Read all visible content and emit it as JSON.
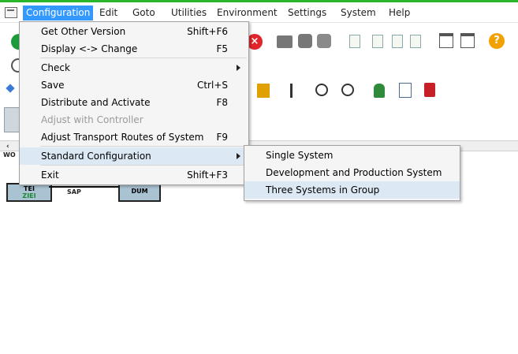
{
  "menubar": {
    "items": [
      "Configuration",
      "Edit",
      "Goto",
      "Utilities",
      "Environment",
      "Settings",
      "System",
      "Help"
    ],
    "active": "Configuration"
  },
  "toolbar_icons": [
    "enter-icon",
    "command-field-icon",
    "cancel-icon",
    "print-icon",
    "find-icon",
    "find-next-icon",
    "first-page-icon",
    "previous-page-icon",
    "next-page-icon",
    "last-page-icon",
    "new-session-icon",
    "shortcut-icon",
    "help-icon"
  ],
  "diagram": {
    "labels": [
      "SAP",
      "TEI",
      "ZIEI",
      "DUM",
      "WO"
    ]
  },
  "configuration_menu": {
    "items": [
      {
        "label": "Get Other Version",
        "shortcut": "Shift+F6",
        "enabled": true
      },
      {
        "label": "Display <-> Change",
        "shortcut": "F5",
        "enabled": true
      },
      {
        "label": "Check",
        "shortcut": "",
        "enabled": true,
        "submenu": true
      },
      {
        "label": "Save",
        "shortcut": "Ctrl+S",
        "enabled": true
      },
      {
        "label": "Distribute and Activate",
        "shortcut": "F8",
        "enabled": true
      },
      {
        "label": "Adjust with Controller",
        "shortcut": "",
        "enabled": false
      },
      {
        "label": "Adjust Transport Routes of System",
        "shortcut": "F9",
        "enabled": true
      },
      {
        "label": "Standard Configuration",
        "shortcut": "",
        "enabled": true,
        "submenu": true,
        "highlighted": true
      },
      {
        "label": "Exit",
        "shortcut": "Shift+F3",
        "enabled": true
      }
    ]
  },
  "standard_configuration_submenu": {
    "items": [
      {
        "label": "Single System"
      },
      {
        "label": "Development and Production System"
      },
      {
        "label": "Three Systems in Group",
        "highlighted": true
      }
    ]
  },
  "colors": {
    "menu_active": "#3399ff",
    "menu_highlight": "#dce9f5",
    "top_bar": "#2ab52a"
  }
}
